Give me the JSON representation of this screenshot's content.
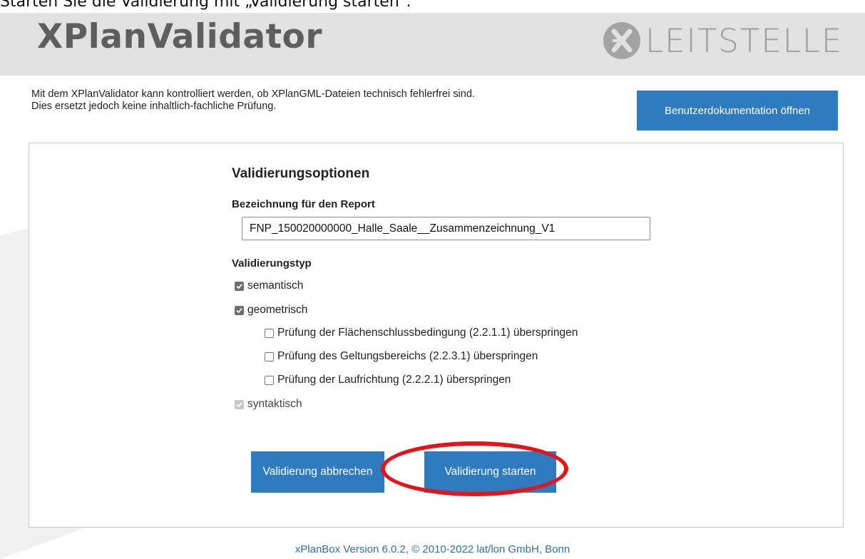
{
  "caption": "Starten Sie die Validierung mit „Validierung starten“.",
  "header": {
    "app_title": "XPlanValidator",
    "logo_text": "LEITSTELLE",
    "logo_icon": "leitstelle-x-logo-icon"
  },
  "intro": {
    "line1": "Mit dem XPlanValidator kann kontrolliert werden, ob XPlanGML-Dateien technisch fehlerfrei sind.",
    "line2": "Dies ersetzt jedoch keine inhaltlich-fachliche Prüfung."
  },
  "doc_button_label": "Benutzerdokumentation öffnen",
  "options": {
    "title": "Validierungsoptionen",
    "report_label": "Bezeichnung für den Report",
    "report_value": "FNP_150020000000_Halle_Saale__Zusammenzeichnung_V1",
    "type_label": "Validierungstyp",
    "semantic": {
      "label": "semantisch",
      "checked": true
    },
    "geometric": {
      "label": "geometrisch",
      "checked": true
    },
    "skip_flaechenschluss": {
      "label": "Prüfung der Flächenschlussbedingung (2.2.1.1) überspringen",
      "checked": false
    },
    "skip_geltungsbereich": {
      "label": "Prüfung des Geltungsbereichs (2.2.3.1) überspringen",
      "checked": false
    },
    "skip_laufrichtung": {
      "label": "Prüfung der Laufrichtung (2.2.2.1) überspringen",
      "checked": false
    },
    "syntactic": {
      "label": "syntaktisch",
      "checked": true,
      "disabled": true
    }
  },
  "buttons": {
    "cancel_label": "Validierung abbrechen",
    "start_label": "Validierung starten"
  },
  "footer": "xPlanBox Version 6.0.2, © 2010-2022 lat/lon GmbH, Bonn",
  "colors": {
    "primary_button": "#2e7bbf",
    "header_bg": "#e1e1e1",
    "highlight": "#e3141b",
    "footer_link": "#2e6ea8"
  }
}
